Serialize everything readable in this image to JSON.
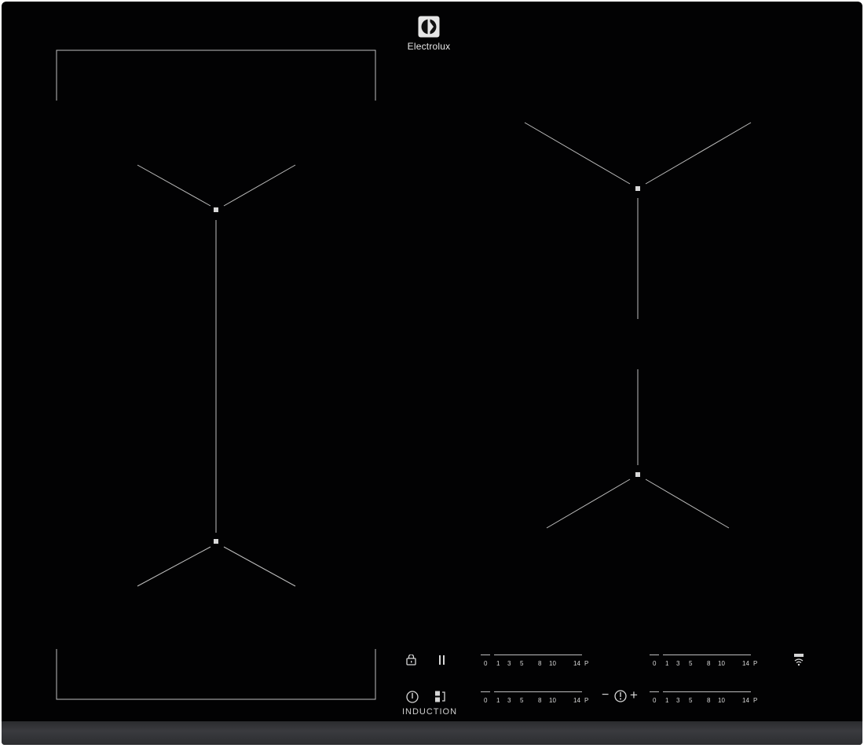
{
  "brand": {
    "name": "Electrolux",
    "icon": "electrolux-logo-icon"
  },
  "controls": {
    "lock_icon": "lock-icon",
    "pause_icon": "pause-icon",
    "power_icon": "power-icon",
    "bridge_icon": "bridge-zone-icon",
    "hob2hood_icon": "hob2hood-wifi-icon",
    "timer": {
      "minus": "−",
      "plus": "+",
      "icon": "timer-icon"
    },
    "induction_label": "INDUCTION"
  },
  "scale_marks": [
    "0",
    "1",
    "3",
    "5",
    "8",
    "10",
    "14",
    "P"
  ],
  "sliders": [
    {
      "zone": "front-left"
    },
    {
      "zone": "rear-left"
    },
    {
      "zone": "rear-right"
    },
    {
      "zone": "front-right"
    }
  ],
  "colors": {
    "glass": "#020203",
    "frame": "#2f3033",
    "markings": "#c8c8c8"
  }
}
